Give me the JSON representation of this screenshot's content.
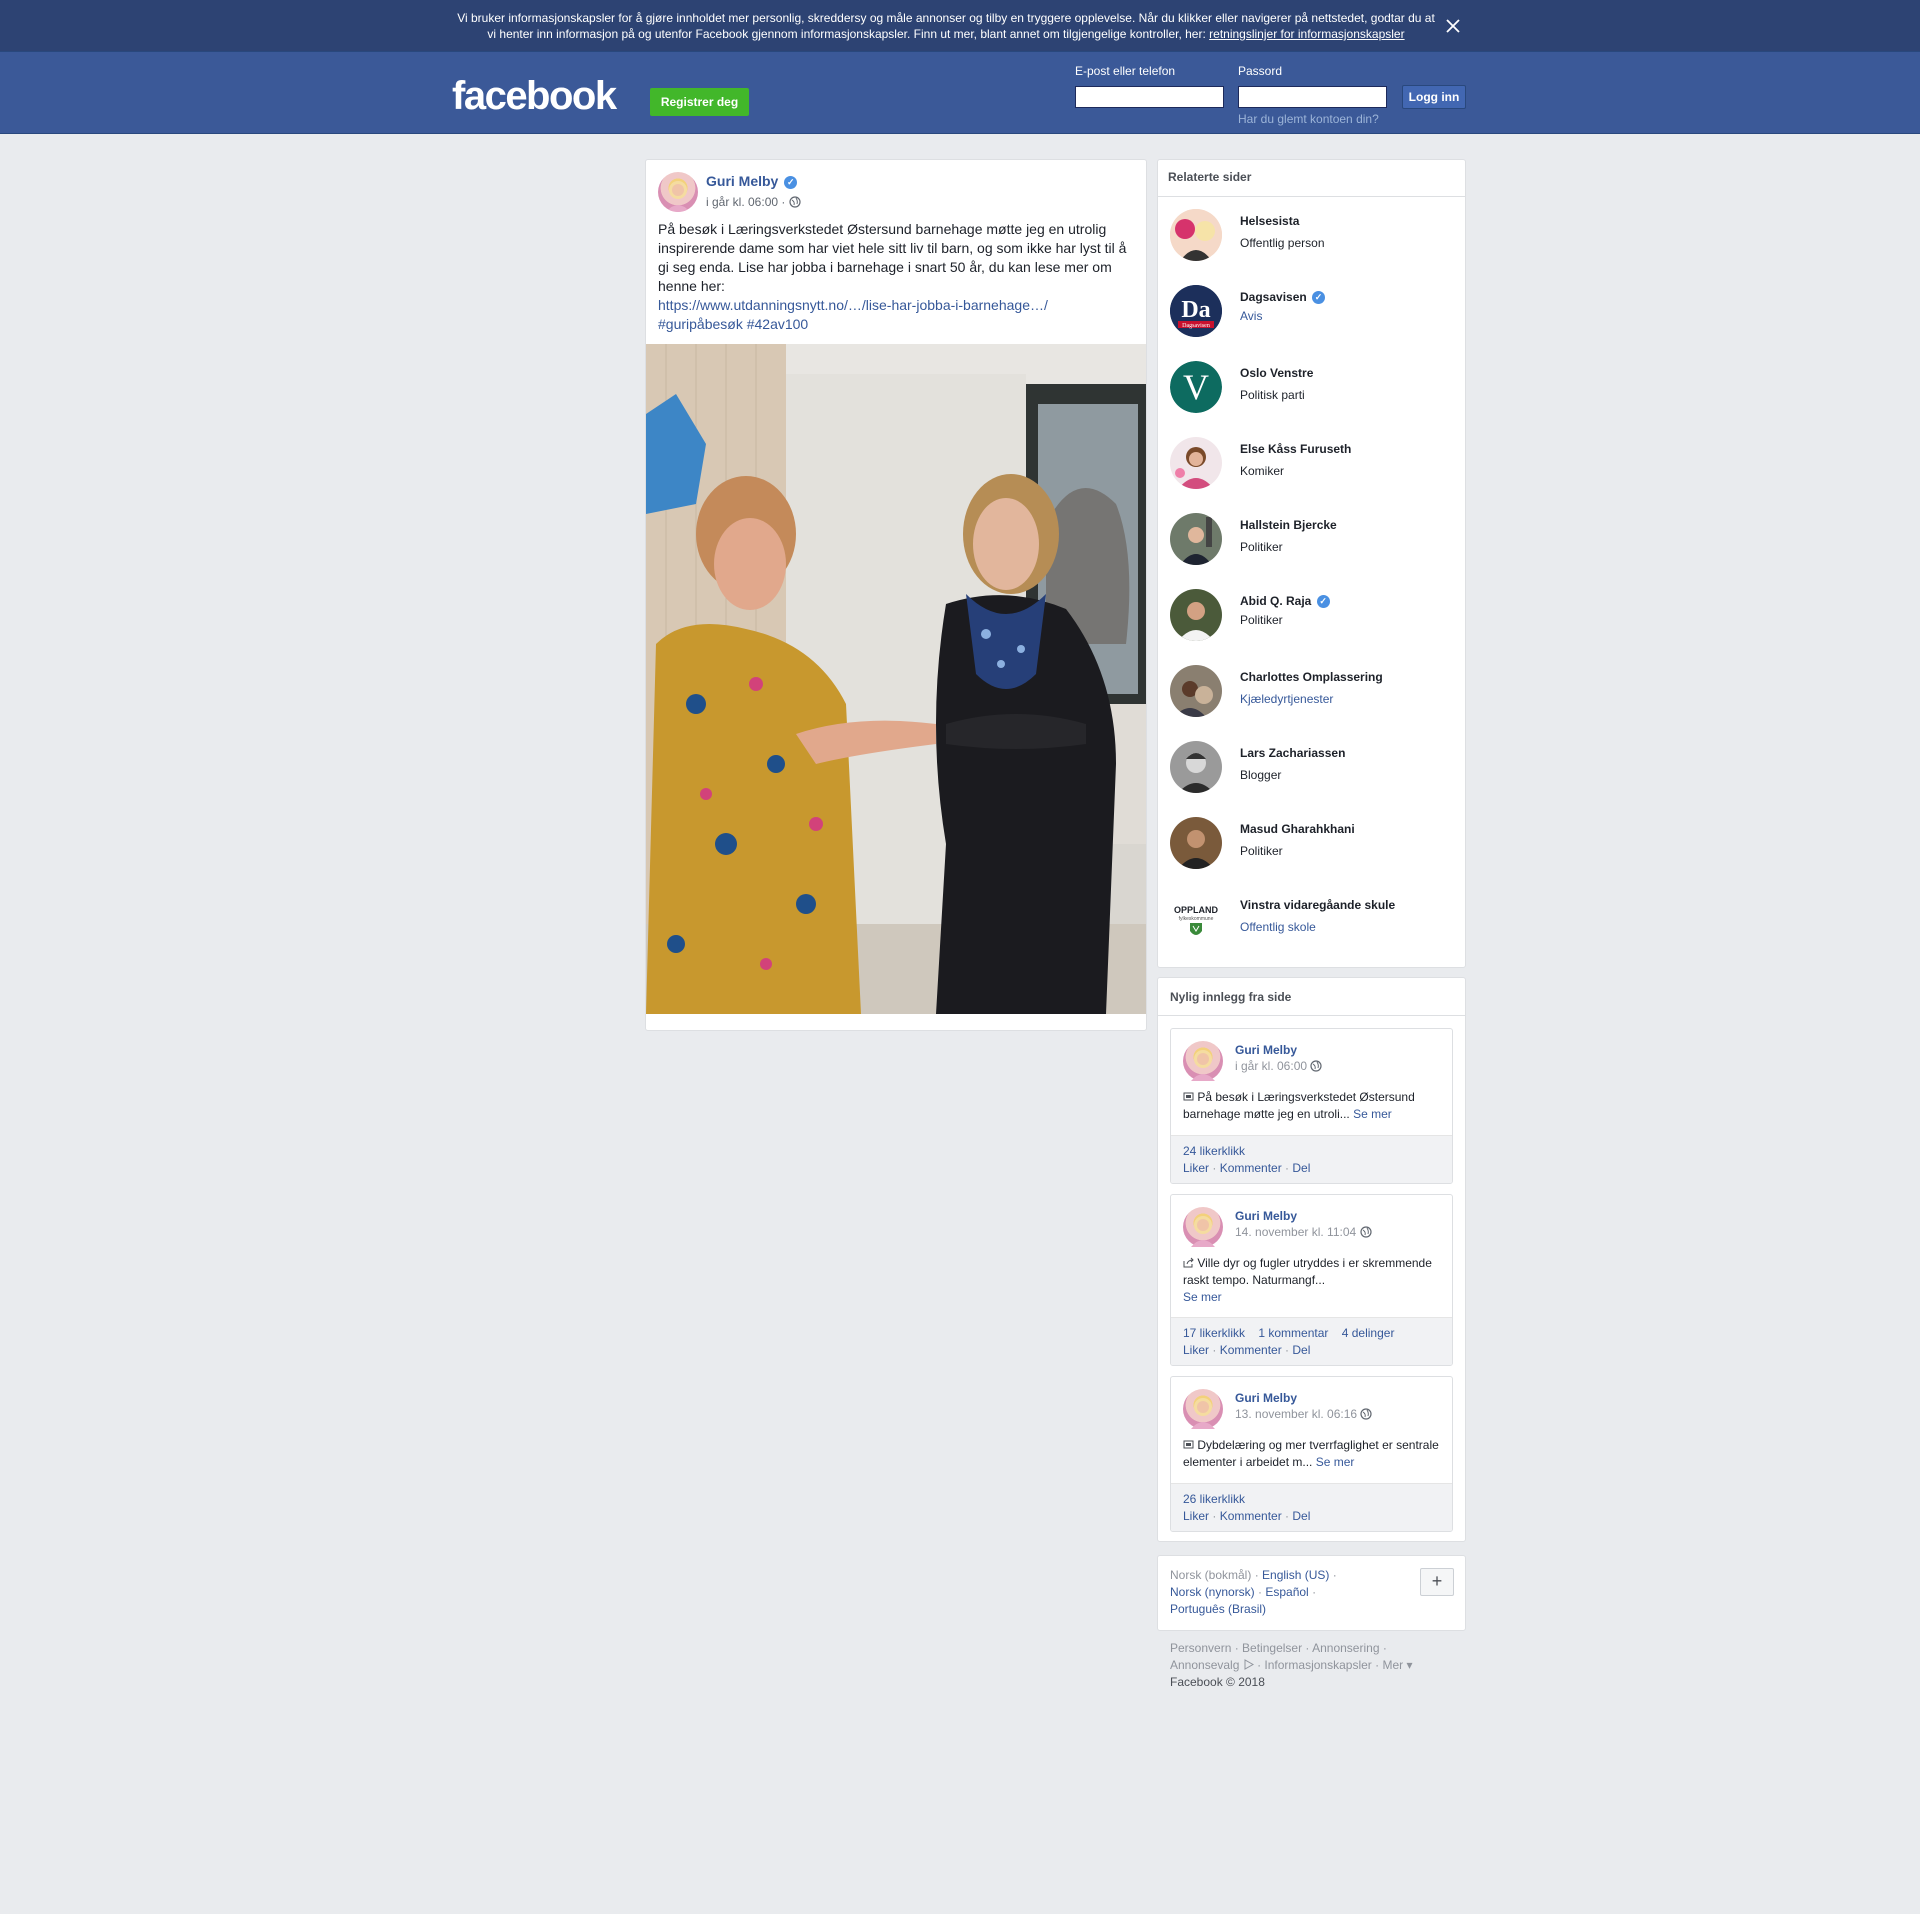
{
  "cookie_banner": {
    "text": "Vi bruker informasjonskapsler for å gjøre innholdet mer personlig, skreddersy og måle annonser og tilby en tryggere opplevelse. Når du klikker eller navigerer på nettstedet, godtar du at vi henter inn informasjon på og utenfor Facebook gjennom informasjonskapsler. Finn ut mer, blant annet om tilgjengelige kontroller, her: ",
    "link": "retningslinjer for informasjonskapsler",
    "close_icon": "close-icon"
  },
  "header": {
    "logo": "facebook",
    "register_label": "Registrer deg",
    "email_label": "E-post eller telefon",
    "email_value": "",
    "password_label": "Passord",
    "password_value": "",
    "login_label": "Logg inn",
    "forgot_label": "Har du glemt kontoen din?"
  },
  "post": {
    "author": "Guri Melby",
    "time": "i går kl. 06:00 · ",
    "text": "På besøk i Læringsverkstedet Østersund barnehage møtte jeg en utrolig inspirerende dame som har viet hele sitt liv til barn, og som ikke har lyst til å gi seg enda. Lise har jobba i barnehage i snart 50 år, du kan lese mer om henne her:",
    "link": "https://www.utdanningsnytt.no/…/lise-har-jobba-i-barnehage…/",
    "hashtags": [
      "#guripåbesøk",
      "#42av100"
    ]
  },
  "related": {
    "title": "Relaterte sider",
    "items": [
      {
        "name": "Helsesista",
        "category": "Offentlig person",
        "verified": false,
        "link_category": false
      },
      {
        "name": "Dagsavisen",
        "category": "Avis",
        "verified": true,
        "link_category": true
      },
      {
        "name": "Oslo Venstre",
        "category": "Politisk parti",
        "verified": false,
        "link_category": false
      },
      {
        "name": "Else Kåss Furuseth",
        "category": "Komiker",
        "verified": false,
        "link_category": false
      },
      {
        "name": "Hallstein Bjercke",
        "category": "Politiker",
        "verified": false,
        "link_category": false
      },
      {
        "name": "Abid Q. Raja",
        "category": "Politiker",
        "verified": true,
        "link_category": false
      },
      {
        "name": "Charlottes Omplassering",
        "category": "Kjæledyrtjenester",
        "verified": false,
        "link_category": true
      },
      {
        "name": "Lars Zachariassen",
        "category": "Blogger",
        "verified": false,
        "link_category": false
      },
      {
        "name": "Masud Gharahkhani",
        "category": "Politiker",
        "verified": false,
        "link_category": false
      },
      {
        "name": "Vinstra vidaregåande skule",
        "category": "Offentlig skole",
        "verified": false,
        "link_category": true
      }
    ],
    "logo_texts": {
      "dagsavisen": "Da",
      "dagsavisen_small": "Dagsavisen",
      "oslo_venstre": "V",
      "oppland": "OPPLAND",
      "oppland_small": "fylkeskommune"
    }
  },
  "recent": {
    "title": "Nylig innlegg fra side",
    "see_more": "Se mer",
    "actions": [
      "Liker",
      "Kommenter",
      "Del"
    ],
    "posts": [
      {
        "author": "Guri Melby",
        "date": "i går kl. 06:00",
        "icon": "photo-icon",
        "text": "På besøk i Læringsverkstedet Østersund barnehage møtte jeg en utroli...",
        "likes": "24 likerklikk",
        "comments": "",
        "shares": ""
      },
      {
        "author": "Guri Melby",
        "date": "14. november kl. 11:04",
        "icon": "share-icon",
        "text": "Ville dyr og fugler utryddes i er skremmende raskt tempo. Naturmangf...",
        "likes": "17 likerklikk",
        "comments": "1 kommentar",
        "shares": "4 delinger"
      },
      {
        "author": "Guri Melby",
        "date": "13. november kl. 06:16",
        "icon": "photo-icon",
        "text": "Dybdelæring og mer tverrfaglighet er sentrale elementer i arbeidet m...",
        "likes": "26 likerklikk",
        "comments": "",
        "shares": ""
      }
    ]
  },
  "languages": {
    "current": "Norsk (bokmål)",
    "options": [
      "English (US)",
      "Norsk (nynorsk)",
      "Español",
      "Português (Brasil)"
    ],
    "plus": "+"
  },
  "footer": {
    "links": [
      "Personvern",
      "Betingelser",
      "Annonsering",
      "Annonsevalg",
      "Informasjonskapsler",
      "Mer"
    ],
    "copyright": "Facebook © 2018"
  }
}
